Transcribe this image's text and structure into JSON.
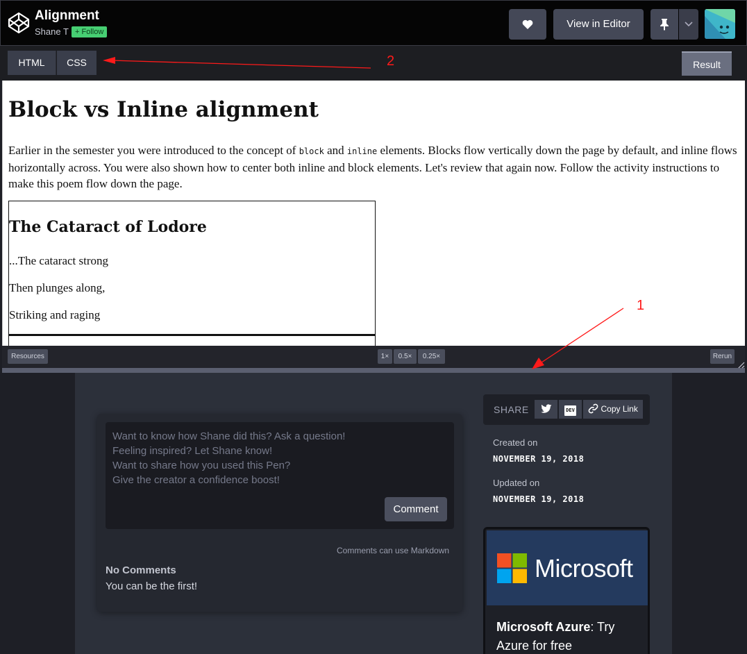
{
  "header": {
    "title": "Alignment",
    "author": "Shane T",
    "follow_label": "+ Follow",
    "view_editor_label": "View in Editor"
  },
  "tabs": {
    "html": "HTML",
    "css": "CSS",
    "result": "Result"
  },
  "annotations": {
    "one": "1",
    "two": "2"
  },
  "result": {
    "heading": "Block vs Inline alignment",
    "intro_part1": "Earlier in the semester you were introduced to the concept of ",
    "code_block": "block",
    "intro_and": " and ",
    "code_inline": "inline",
    "intro_part2": " elements. Blocks flow vertically down the page by default, and inline flows horizontally across. You were also shown how to center both inline and block elements. Let's review that again now. Follow the activity instructions to make this poem flow down the page.",
    "poem_title": "The Cataract of Lodore",
    "lines": [
      "...The cataract strong",
      "Then plunges along,",
      "Striking and raging"
    ]
  },
  "result_footer": {
    "resources": "Resources",
    "zoom": [
      "1×",
      "0.5×",
      "0.25×"
    ],
    "rerun": "Rerun"
  },
  "comments": {
    "placeholder_lines": [
      "Want to know how Shane did this? Ask a question!",
      "Feeling inspired? Let Shane know!",
      "Want to share how you used this Pen?",
      "Give the creator a confidence boost!"
    ],
    "submit_label": "Comment",
    "markdown_note": "Comments can use Markdown",
    "empty_title": "No Comments",
    "empty_sub": "You can be the first!"
  },
  "share": {
    "label": "SHARE",
    "dev": "DEV",
    "copy_link": "Copy Link"
  },
  "meta": {
    "created_label": "Created on",
    "created_value": "NOVEMBER 19, 2018",
    "updated_label": "Updated on",
    "updated_value": "NOVEMBER 19, 2018"
  },
  "ad": {
    "brand": "Microsoft",
    "headline_bold": "Microsoft Azure",
    "headline_rest": ": Try Azure for free"
  },
  "colors": {
    "follow_green": "#47cf73",
    "header_bg": "#050505",
    "annotation_red": "#ff1a1a",
    "ms_banner": "#243a5e"
  }
}
